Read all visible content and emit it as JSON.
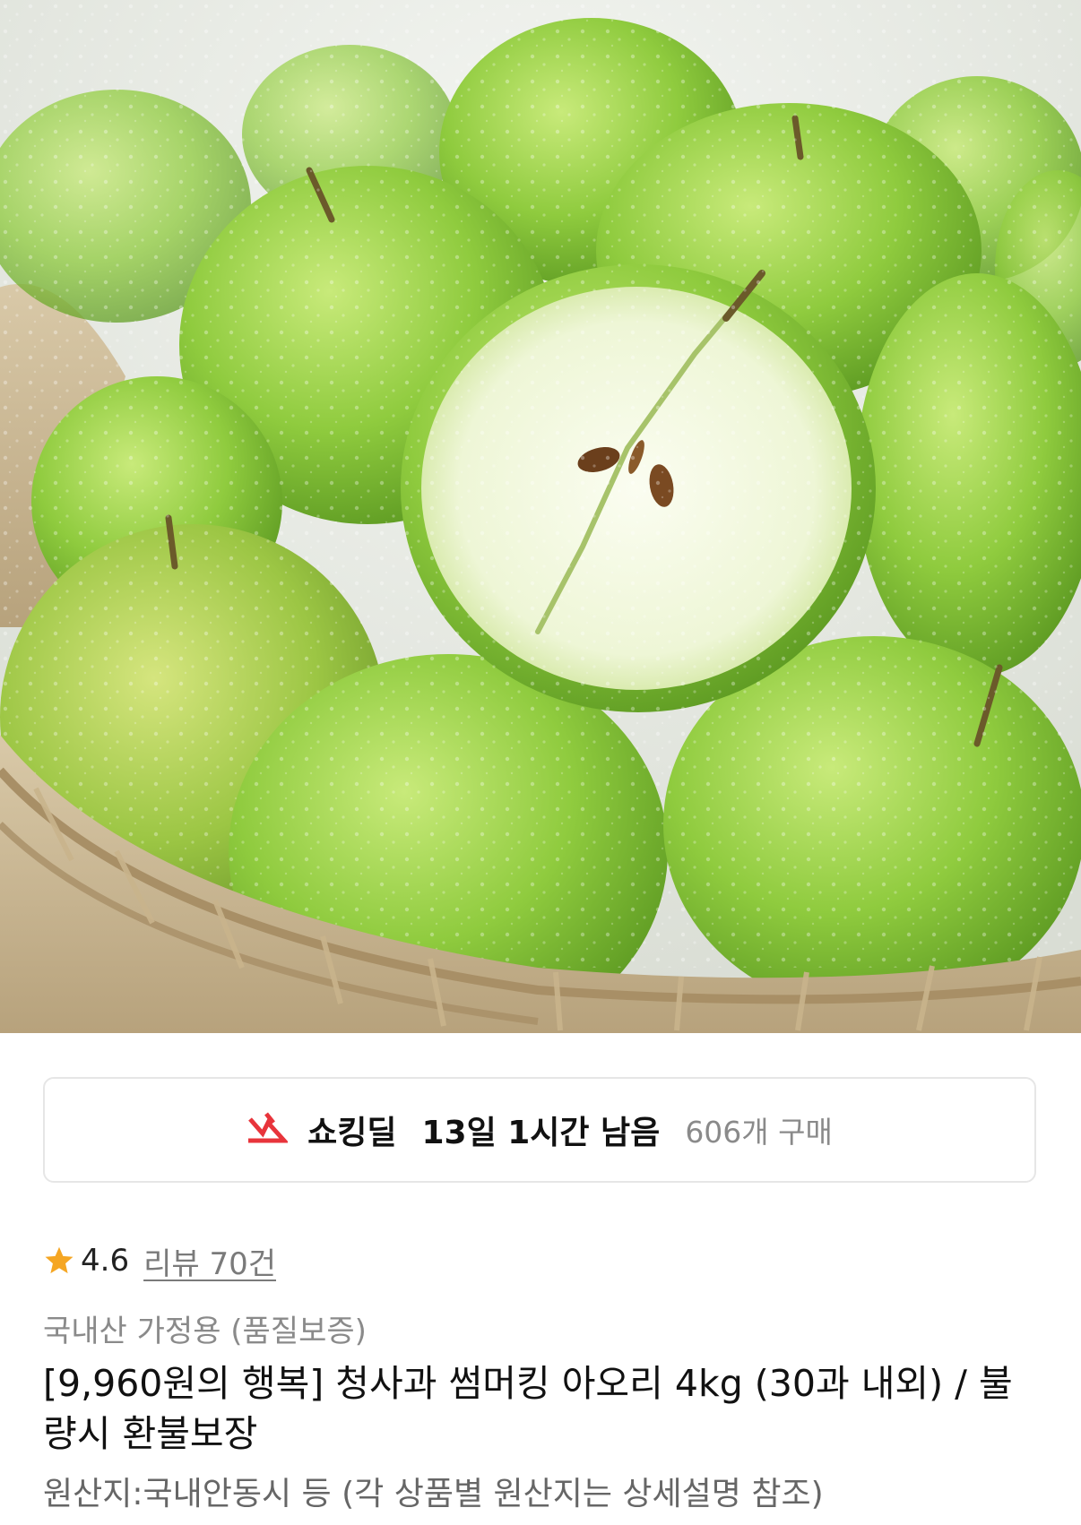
{
  "hero": {
    "image_icon": "green-apples-photo-icon"
  },
  "deal": {
    "icon": "lightning-bolt-icon",
    "label": "쇼킹딜",
    "time_remaining": "13일 1시간 남음",
    "purchase_count": "606개 구매",
    "accent_color": "#e8343b"
  },
  "rating": {
    "icon": "star-icon",
    "star_color": "#f5a623",
    "value": "4.6",
    "review_label": "리뷰 70건"
  },
  "product": {
    "category": "국내산 가정용 (품질보증)",
    "title": "[9,960원의 행복] 청사과 썸머킹 아오리 4kg (30과 내외) / 불량시 환불보장",
    "origin": "원산지:국내안동시 등 (각 상품별 원산지는 상세설명 참조)"
  }
}
